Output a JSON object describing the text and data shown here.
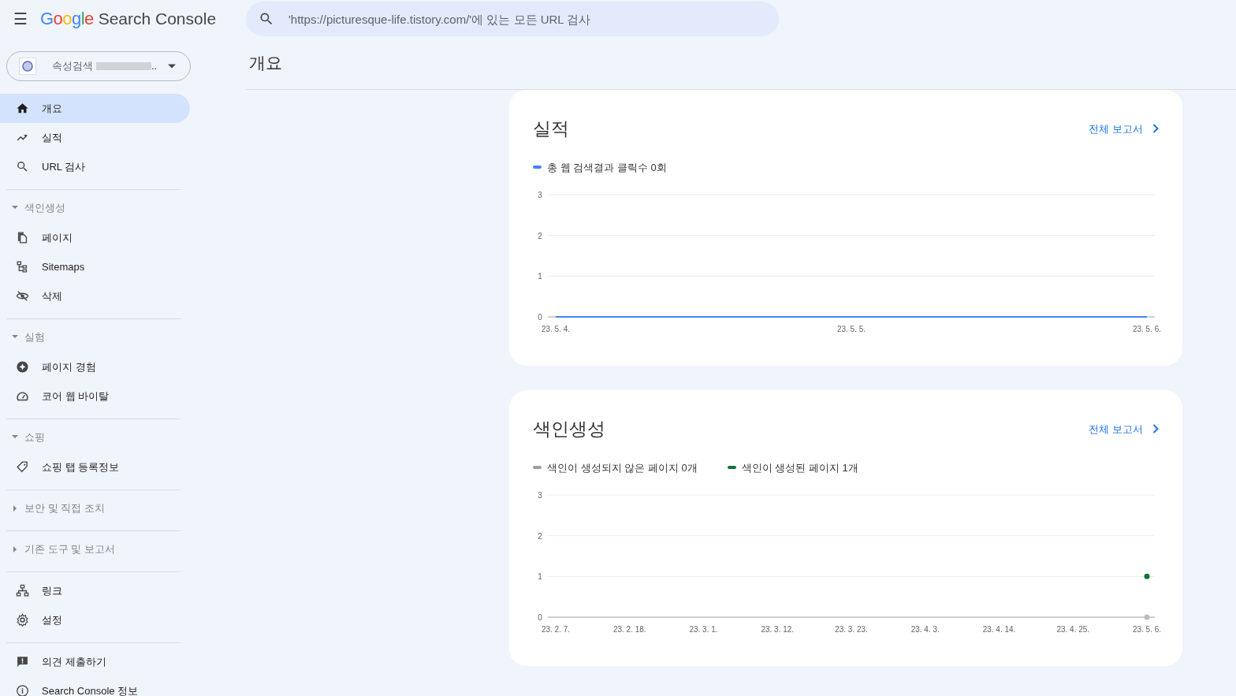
{
  "header": {
    "menu_glyph": "☰",
    "logo": "Google",
    "product": "Search Console",
    "search": {
      "placeholder": "'https://picturesque-life.tistory.com/'에 있는 모든 URL 검사"
    }
  },
  "property": {
    "label": "속성검색",
    "suffix": ".."
  },
  "sidebar": {
    "groups": [
      {
        "items": [
          {
            "label": "개요",
            "selected": true
          },
          {
            "label": "실적",
            "selected": false
          },
          {
            "label": "URL 검사",
            "selected": false
          }
        ]
      },
      {
        "heading": {
          "label": "색인생성",
          "expanded": true
        },
        "items": [
          {
            "label": "페이지",
            "selected": false
          },
          {
            "label": "Sitemaps",
            "selected": false
          },
          {
            "label": "삭제",
            "selected": false
          }
        ]
      },
      {
        "heading": {
          "label": "실험",
          "expanded": true
        },
        "items": [
          {
            "label": "페이지 경험",
            "selected": false
          },
          {
            "label": "코어 웹 바이탈",
            "selected": false
          }
        ]
      },
      {
        "heading": {
          "label": "쇼핑",
          "expanded": true
        },
        "items": [
          {
            "label": "쇼핑 탭 등록정보",
            "selected": false
          }
        ]
      },
      {
        "heading": {
          "label": "보안 및 직접 조치",
          "expanded": false
        }
      },
      {
        "heading": {
          "label": "기존 도구 및 보고서",
          "expanded": false
        }
      },
      {
        "items": [
          {
            "label": "링크",
            "selected": false
          },
          {
            "label": "설정",
            "selected": false
          }
        ]
      },
      {
        "items": [
          {
            "label": "의견 제출하기",
            "selected": false
          },
          {
            "label": "Search Console 정보",
            "selected": false
          }
        ]
      }
    ]
  },
  "page_title": "개요",
  "cards": [
    {
      "title": "실적",
      "link": "전체 보고서",
      "legend": [
        {
          "label": "총 웹 검색결과 클릭수 0회",
          "color": "#4285f4"
        }
      ],
      "chart_data": {
        "type": "line",
        "categories": [
          "23. 5. 4.",
          "23. 5. 5.",
          "23. 5. 6."
        ],
        "series": [
          {
            "color": "#4285f4",
            "marker": false,
            "values": [
              0,
              0,
              0
            ]
          }
        ],
        "ylim": [
          0,
          3
        ],
        "yticks": [
          0,
          1,
          2,
          3
        ]
      }
    },
    {
      "title": "색인생성",
      "link": "전체 보고서",
      "legend": [
        {
          "label": "색인이 생성되지 않은 페이지 0개",
          "color": "#9e9e9e"
        },
        {
          "label": "색인이 생성된 페이지 1개",
          "color": "#137333"
        }
      ],
      "chart_data": {
        "type": "line",
        "categories": [
          "23. 2. 7.",
          "23. 2. 18.",
          "23. 3. 1.",
          "23. 3. 12.",
          "23. 3. 23.",
          "23. 4. 3.",
          "23. 4. 14.",
          "23. 4. 25.",
          "23. 5. 6."
        ],
        "series": [
          {
            "color": "#bdbdbd",
            "marker": true,
            "values": [
              null,
              null,
              null,
              null,
              null,
              null,
              null,
              null,
              0
            ]
          },
          {
            "color": "#137333",
            "marker": true,
            "values": [
              null,
              null,
              null,
              null,
              null,
              null,
              null,
              null,
              1
            ]
          }
        ],
        "ylim": [
          0,
          3
        ],
        "yticks": [
          0,
          1,
          2,
          3
        ]
      }
    }
  ]
}
